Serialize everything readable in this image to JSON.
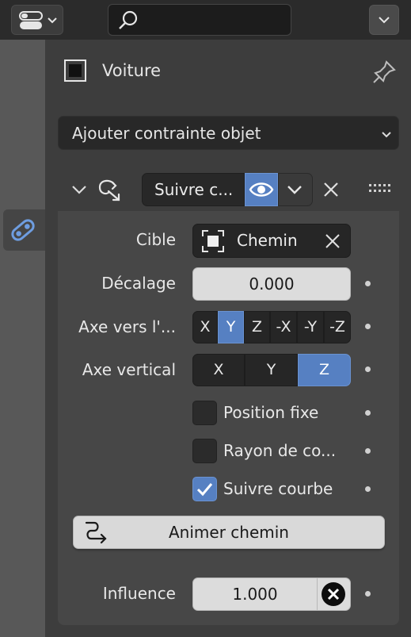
{
  "header": {
    "editor_type_icon": "properties-editor-icon",
    "search": {
      "value": "",
      "placeholder": ""
    },
    "options_icon": "chevron-down-icon"
  },
  "tabs": [
    {
      "name": "object-constraint-properties",
      "icon": "constraint-icon",
      "active": true
    }
  ],
  "context": {
    "object_name": "Voiture",
    "object_icon": "object-icon",
    "pin_icon": "pin-icon"
  },
  "add_constraint": {
    "label": "Ajouter contrainte objet"
  },
  "constraint": {
    "name": "Suivre c...",
    "type_icon": "follow-path-icon",
    "expanded": true,
    "enabled": true,
    "fields": {
      "target": {
        "label": "Cible",
        "value": "Chemin"
      },
      "offset": {
        "label": "Décalage",
        "value": "0.000"
      },
      "forward_axis": {
        "label": "Axe vers l'...",
        "options": [
          "X",
          "Y",
          "Z",
          "-X",
          "-Y",
          "-Z"
        ],
        "selected": "Y"
      },
      "up_axis": {
        "label": "Axe vertical",
        "options": [
          "X",
          "Y",
          "Z"
        ],
        "selected": "Z"
      },
      "fixed_position": {
        "label": "Position fixe",
        "checked": false
      },
      "curve_radius": {
        "label": "Rayon de co...",
        "checked": false
      },
      "follow_curve": {
        "label": "Suivre courbe",
        "checked": true
      },
      "animate_path": {
        "label": "Animer chemin"
      },
      "influence": {
        "label": "Influence",
        "value": "1.000"
      }
    }
  },
  "colors": {
    "accent": "#5680c2",
    "panel_bg": "#3d3d3d",
    "subpanel_bg": "#474747",
    "field_dark": "#262626",
    "field_light": "#dcdcdc"
  }
}
